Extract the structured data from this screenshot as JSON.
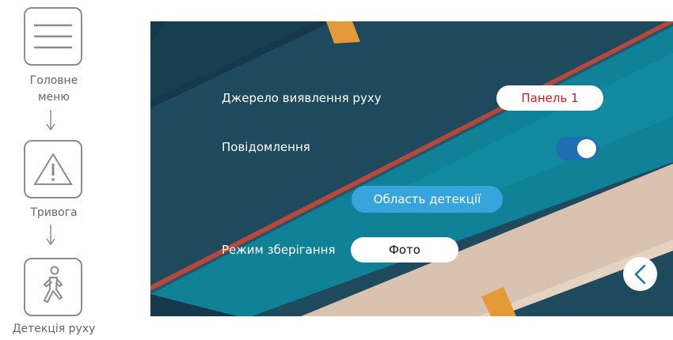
{
  "navigation": {
    "steps": [
      {
        "label": "Головне меню",
        "icon": "hamburger-menu-icon"
      },
      {
        "label": "Тривога",
        "icon": "warning-triangle-icon"
      },
      {
        "label": "Детекція руху",
        "icon": "walking-person-icon"
      }
    ],
    "arrow_icon": "down-arrow-icon",
    "label_line1": "Головне",
    "label_line2": "меню"
  },
  "screen": {
    "motion_source": {
      "label": "Джерело виявлення руху",
      "value": "Панель 1"
    },
    "notifications": {
      "label": "Повідомлення",
      "enabled": true
    },
    "detection_area": {
      "label": "Область детекції"
    },
    "storage_mode": {
      "label": "Режим зберігання",
      "value": "Фото"
    },
    "back_icon": "chevron-left-icon"
  },
  "colors": {
    "accent_blue": "#37a4dc",
    "toggle_on": "#1f6fb5",
    "value_red": "#d71c1c",
    "nav_border": "#8c8c8c"
  }
}
